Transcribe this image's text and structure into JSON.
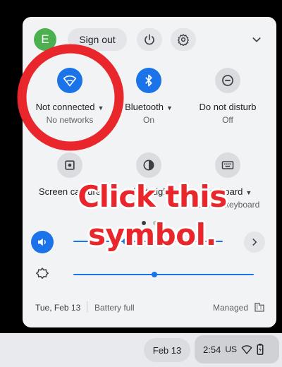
{
  "header": {
    "avatar_letter": "E",
    "sign_out_label": "Sign out"
  },
  "tiles": [
    {
      "label": "Not connected",
      "sub": "No networks",
      "icon": "wifi-icon",
      "active": true,
      "has_menu": true
    },
    {
      "label": "Bluetooth",
      "sub": "On",
      "icon": "bluetooth-icon",
      "active": true,
      "has_menu": true
    },
    {
      "label": "Do not disturb",
      "sub": "Off",
      "icon": "do-not-disturb-icon",
      "active": false,
      "has_menu": false
    },
    {
      "label": "Screen capture",
      "icon": "screen-capture-icon",
      "active": false
    },
    {
      "label": "Night Light",
      "icon": "night-light-icon",
      "active": false
    },
    {
      "label": "Keyboard",
      "sub": "Screen keyboard",
      "icon": "keyboard-icon",
      "active": false,
      "has_menu": true
    }
  ],
  "sliders": {
    "volume_level": 0.35,
    "brightness_level": 0.45
  },
  "footer": {
    "date": "Tue, Feb 13",
    "battery": "Battery full",
    "managed": "Managed"
  },
  "shelf": {
    "date": "Feb 13",
    "time": "2:54",
    "locale": "US"
  },
  "annotation": {
    "text_line1": "Click this",
    "text_line2": "symbol.",
    "color": "#e8262b"
  },
  "colors": {
    "accent": "#1a73e8",
    "panel": "#f1f3f4"
  }
}
